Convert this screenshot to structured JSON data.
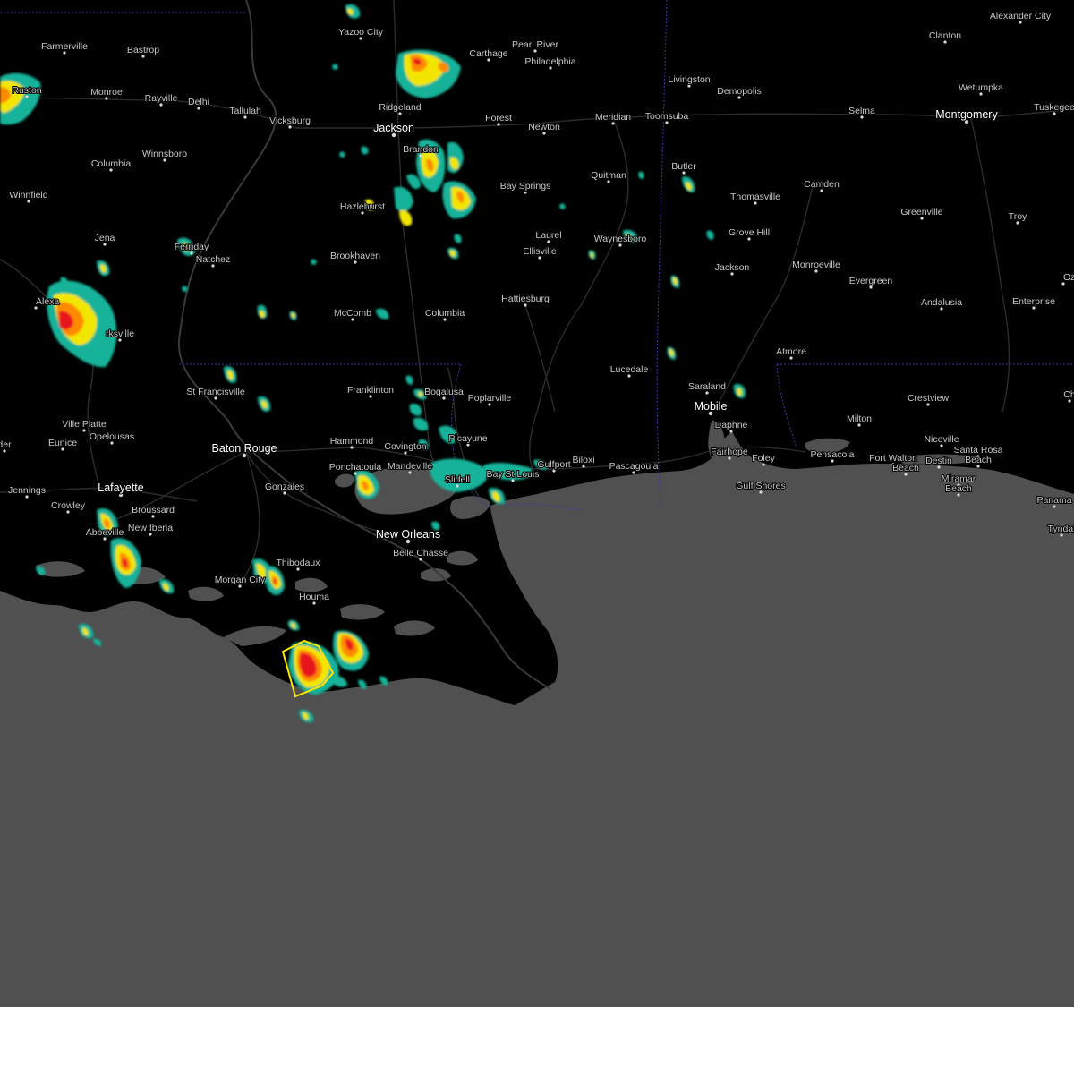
{
  "colors": {
    "land": "#000000",
    "water": "#505050",
    "roads": "#2f2f2f",
    "state_border": "#3a3aa8",
    "warning_outline": "#ffe600",
    "radar_light": "#14b39a",
    "radar_mid": "#f2e600",
    "radar_heavy": "#ff8a00",
    "radar_intense": "#e8171d"
  },
  "map": {
    "cities": [
      {
        "id": "farmerville",
        "name": "Farmerville",
        "size": "small"
      },
      {
        "id": "bastrop",
        "name": "Bastrop",
        "size": "small"
      },
      {
        "id": "ruston",
        "name": "Ruston",
        "size": "small"
      },
      {
        "id": "monroe",
        "name": "Monroe",
        "size": "small"
      },
      {
        "id": "rayville",
        "name": "Rayville",
        "size": "small"
      },
      {
        "id": "delhi",
        "name": "Delhi",
        "size": "small"
      },
      {
        "id": "tallulah",
        "name": "Tallulah",
        "size": "small"
      },
      {
        "id": "vicksburg",
        "name": "Vicksburg",
        "size": "small"
      },
      {
        "id": "yazoo",
        "name": "Yazoo City",
        "size": "small"
      },
      {
        "id": "carthage",
        "name": "Carthage",
        "size": "small"
      },
      {
        "id": "pearl-river",
        "name": "Pearl River",
        "size": "small"
      },
      {
        "id": "philadelphia",
        "name": "Philadelphia",
        "size": "small"
      },
      {
        "id": "ridgeland",
        "name": "Ridgeland",
        "size": "small"
      },
      {
        "id": "jackson",
        "name": "Jackson",
        "size": "big"
      },
      {
        "id": "forest",
        "name": "Forest",
        "size": "small"
      },
      {
        "id": "newton",
        "name": "Newton",
        "size": "small"
      },
      {
        "id": "meridian",
        "name": "Meridian",
        "size": "small"
      },
      {
        "id": "toomsuba",
        "name": "Toomsuba",
        "size": "small"
      },
      {
        "id": "livingston",
        "name": "Livingston",
        "size": "small"
      },
      {
        "id": "demopolis",
        "name": "Demopolis",
        "size": "small"
      },
      {
        "id": "clanton",
        "name": "Clanton",
        "size": "small"
      },
      {
        "id": "alexander-city",
        "name": "Alexander City",
        "size": "small"
      },
      {
        "id": "wetumpka",
        "name": "Wetumpka",
        "size": "small"
      },
      {
        "id": "selma",
        "name": "Selma",
        "size": "small"
      },
      {
        "id": "montgomery",
        "name": "Montgomery",
        "size": "big"
      },
      {
        "id": "tuskegee",
        "name": "Tuskegee",
        "size": "small"
      },
      {
        "id": "columbia-la",
        "name": "Columbia",
        "size": "small"
      },
      {
        "id": "winnsboro",
        "name": "Winnsboro",
        "size": "small"
      },
      {
        "id": "brandon",
        "name": "Brandon",
        "size": "small"
      },
      {
        "id": "bay-springs",
        "name": "Bay Springs",
        "size": "small"
      },
      {
        "id": "quitman",
        "name": "Quitman",
        "size": "small"
      },
      {
        "id": "butler",
        "name": "Butler",
        "size": "small"
      },
      {
        "id": "thomasville",
        "name": "Thomasville",
        "size": "small"
      },
      {
        "id": "camden",
        "name": "Camden",
        "size": "small"
      },
      {
        "id": "greenville",
        "name": "Greenville",
        "size": "small"
      },
      {
        "id": "troy",
        "name": "Troy",
        "size": "small"
      },
      {
        "id": "winnfield",
        "name": "Winnfield",
        "size": "small"
      },
      {
        "id": "hazlehurst",
        "name": "Hazlehurst",
        "size": "small"
      },
      {
        "id": "jena",
        "name": "Jena",
        "size": "small"
      },
      {
        "id": "ferriday",
        "name": "Ferriday",
        "size": "small"
      },
      {
        "id": "natchez",
        "name": "Natchez",
        "size": "small"
      },
      {
        "id": "brookhaven",
        "name": "Brookhaven",
        "size": "small"
      },
      {
        "id": "laurel",
        "name": "Laurel",
        "size": "small"
      },
      {
        "id": "ellisville",
        "name": "Ellisville",
        "size": "small"
      },
      {
        "id": "waynesboro",
        "name": "Waynesboro",
        "size": "small"
      },
      {
        "id": "grove-hill",
        "name": "Grove Hill",
        "size": "small"
      },
      {
        "id": "jackson-al",
        "name": "Jackson",
        "size": "small"
      },
      {
        "id": "monroeville",
        "name": "Monroeville",
        "size": "small"
      },
      {
        "id": "evergreen",
        "name": "Evergreen",
        "size": "small"
      },
      {
        "id": "andalusia",
        "name": "Andalusia",
        "size": "small"
      },
      {
        "id": "enterprise",
        "name": "Enterprise",
        "size": "small"
      },
      {
        "id": "ozark",
        "name": "Ozark",
        "size": "small"
      },
      {
        "id": "alexandria",
        "name": "Alexa",
        "size": "small"
      },
      {
        "id": "marksville",
        "name": "rksville",
        "size": "small"
      },
      {
        "id": "mccomb",
        "name": "McComb",
        "size": "small"
      },
      {
        "id": "columbia-ms",
        "name": "Columbia",
        "size": "small"
      },
      {
        "id": "hattiesburg",
        "name": "Hattiesburg",
        "size": "small"
      },
      {
        "id": "lucedale",
        "name": "Lucedale",
        "size": "small"
      },
      {
        "id": "atmore",
        "name": "Atmore",
        "size": "small"
      },
      {
        "id": "st-francisville",
        "name": "St Francisville",
        "size": "small"
      },
      {
        "id": "franklinton",
        "name": "Franklinton",
        "size": "small"
      },
      {
        "id": "bogalusa",
        "name": "Bogalusa",
        "size": "small"
      },
      {
        "id": "poplarville",
        "name": "Poplarville",
        "size": "small"
      },
      {
        "id": "saraland",
        "name": "Saraland",
        "size": "small"
      },
      {
        "id": "mobile",
        "name": "Mobile",
        "size": "big"
      },
      {
        "id": "crestview",
        "name": "Crestview",
        "size": "small"
      },
      {
        "id": "ville-platte",
        "name": "Ville Platte",
        "size": "small"
      },
      {
        "id": "eunice",
        "name": "Eunice",
        "size": "small"
      },
      {
        "id": "opelousas",
        "name": "Opelousas",
        "size": "small"
      },
      {
        "id": "baton-rouge",
        "name": "Baton Rouge",
        "size": "big"
      },
      {
        "id": "hammond",
        "name": "Hammond",
        "size": "small"
      },
      {
        "id": "covington",
        "name": "Covington",
        "size": "small"
      },
      {
        "id": "picayune",
        "name": "Picayune",
        "size": "small"
      },
      {
        "id": "milton",
        "name": "Milton",
        "size": "small"
      },
      {
        "id": "niceville",
        "name": "Niceville",
        "size": "small"
      },
      {
        "id": "daphne",
        "name": "Daphne",
        "size": "small"
      },
      {
        "id": "fairhope",
        "name": "Fairhope",
        "size": "small"
      },
      {
        "id": "foley",
        "name": "Foley",
        "size": "small"
      },
      {
        "id": "pensacola",
        "name": "Pensacola",
        "size": "small"
      },
      {
        "id": "fort-walton",
        "name": "Fort Walton",
        "size": "small"
      },
      {
        "id": "fort-walton-beach",
        "name": "Beach",
        "size": "small"
      },
      {
        "id": "destin",
        "name": "Destin",
        "size": "small"
      },
      {
        "id": "santa-rosa",
        "name": "Santa Rosa",
        "size": "small"
      },
      {
        "id": "santa-rosa-beach",
        "name": "Beach",
        "size": "small"
      },
      {
        "id": "ponchatoula",
        "name": "Ponchatoula",
        "size": "small"
      },
      {
        "id": "mandeville",
        "name": "Mandeville",
        "size": "small"
      },
      {
        "id": "slidell",
        "name": "Slidell",
        "size": "small"
      },
      {
        "id": "bay-st-louis",
        "name": "Bay St Louis",
        "size": "small"
      },
      {
        "id": "gulfport",
        "name": "Gulfport",
        "size": "small"
      },
      {
        "id": "biloxi",
        "name": "Biloxi",
        "size": "small"
      },
      {
        "id": "pascagoula",
        "name": "Pascagoula",
        "size": "small"
      },
      {
        "id": "gulf-shores",
        "name": "Gulf Shores",
        "size": "small"
      },
      {
        "id": "miramar",
        "name": "Miramar",
        "size": "small"
      },
      {
        "id": "miramar-beach",
        "name": "Beach",
        "size": "small"
      },
      {
        "id": "jennings",
        "name": "Jennings",
        "size": "small"
      },
      {
        "id": "lafayette",
        "name": "Lafayette",
        "size": "big"
      },
      {
        "id": "gonzales",
        "name": "Gonzales",
        "size": "small"
      },
      {
        "id": "crowley",
        "name": "Crowley",
        "size": "small"
      },
      {
        "id": "broussard",
        "name": "Broussard",
        "size": "small"
      },
      {
        "id": "new-iberia",
        "name": "New Iberia",
        "size": "small"
      },
      {
        "id": "abbeville",
        "name": "Abbeville",
        "size": "small"
      },
      {
        "id": "new-orleans",
        "name": "New Orleans",
        "size": "big"
      },
      {
        "id": "belle-chasse",
        "name": "Belle Chasse",
        "size": "small"
      },
      {
        "id": "thibodaux",
        "name": "Thibodaux",
        "size": "small"
      },
      {
        "id": "morgan-city",
        "name": "Morgan City",
        "size": "small"
      },
      {
        "id": "houma",
        "name": "Houma",
        "size": "small"
      },
      {
        "id": "panama",
        "name": "Panama",
        "size": "small"
      },
      {
        "id": "tyndall",
        "name": "Tyndal",
        "size": "small"
      },
      {
        "id": "edge-der",
        "name": "der",
        "size": "small"
      },
      {
        "id": "edge-ch",
        "name": "Ch",
        "size": "small"
      }
    ]
  }
}
